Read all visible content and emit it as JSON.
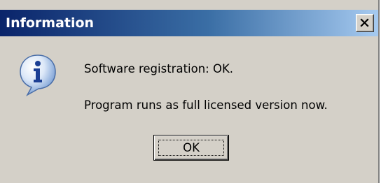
{
  "window": {
    "title": "Information",
    "close_icon": "close-icon"
  },
  "message": {
    "icon": "info-icon",
    "line1": "Software registration: OK.",
    "line2": "Program runs as full licensed version now."
  },
  "buttons": {
    "ok_label": "OK"
  },
  "colors": {
    "dialog_bg": "#d4d0c8",
    "title_gradient_start": "#0a246a",
    "title_gradient_end": "#a6caf0",
    "title_text": "#ffffff"
  }
}
